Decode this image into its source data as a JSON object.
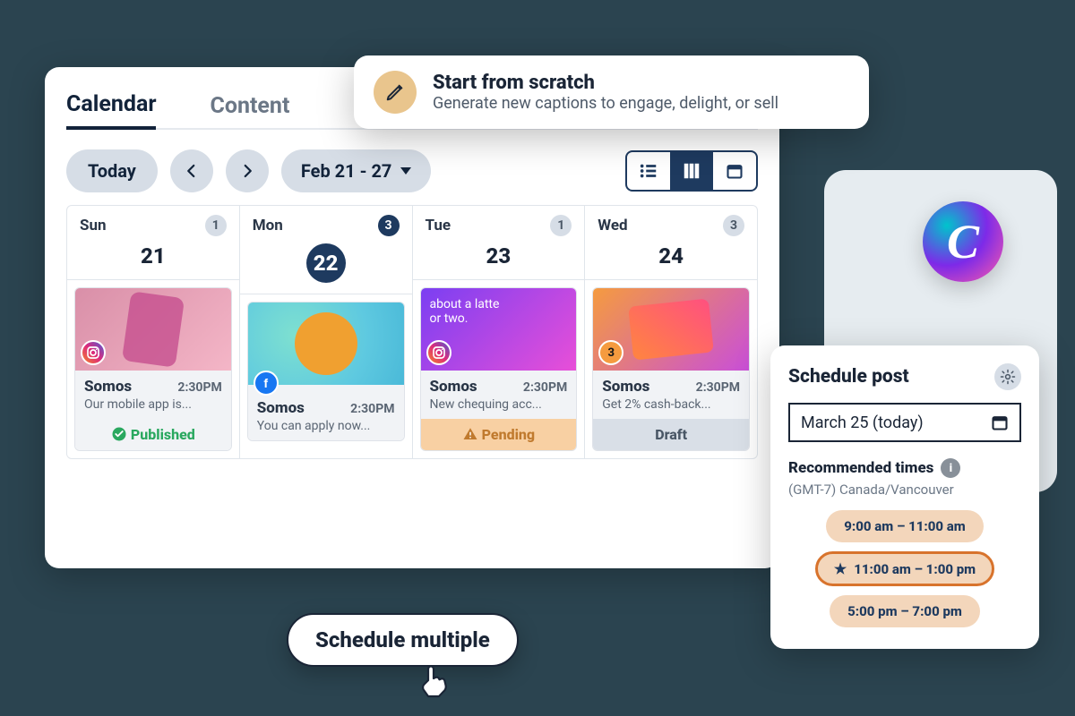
{
  "tabs": {
    "calendar": "Calendar",
    "content": "Content"
  },
  "toolbar": {
    "today": "Today",
    "range": "Feb 21 - 27"
  },
  "days": [
    {
      "name": "Sun",
      "num": "21",
      "count": "1",
      "countDark": false,
      "active": false,
      "card": {
        "network": "ig",
        "title": "Somos",
        "time": "2:30PM",
        "text": "Our mobile app is...",
        "status": "Published",
        "statusClass": "published",
        "thumbText": ""
      }
    },
    {
      "name": "Mon",
      "num": "22",
      "count": "3",
      "countDark": true,
      "active": true,
      "card": {
        "network": "fb",
        "title": "Somos",
        "time": "2:30PM",
        "text": "You can apply now...",
        "status": "",
        "statusClass": "",
        "thumbText": ""
      }
    },
    {
      "name": "Tue",
      "num": "23",
      "count": "1",
      "countDark": false,
      "active": false,
      "card": {
        "network": "ig",
        "title": "Somos",
        "time": "2:30PM",
        "text": "New chequing acc...",
        "status": "Pending",
        "statusClass": "pending",
        "thumbText": "about a latte\nor two."
      }
    },
    {
      "name": "Wed",
      "num": "24",
      "count": "3",
      "countDark": false,
      "active": false,
      "card": {
        "network": "num3",
        "title": "Somos",
        "time": "2:30PM",
        "text": "Get 2% cash-back...",
        "status": "Draft",
        "statusClass": "draft",
        "thumbText": ""
      }
    }
  ],
  "callout": {
    "title": "Start from scratch",
    "sub": "Generate new captions to engage, delight, or sell"
  },
  "scheduleMultiple": "Schedule multiple",
  "schedulePanel": {
    "title": "Schedule post",
    "date": "March 25 (today)",
    "recHeader": "Recommended times",
    "tz": "(GMT-7) Canada/Vancouver",
    "slots": [
      {
        "label": "9:00 am – 11:00 am",
        "featured": false
      },
      {
        "label": "11:00 am – 1:00 pm",
        "featured": true
      },
      {
        "label": "5:00 pm – 7:00 pm",
        "featured": false
      }
    ]
  },
  "badgeNum3": "3"
}
